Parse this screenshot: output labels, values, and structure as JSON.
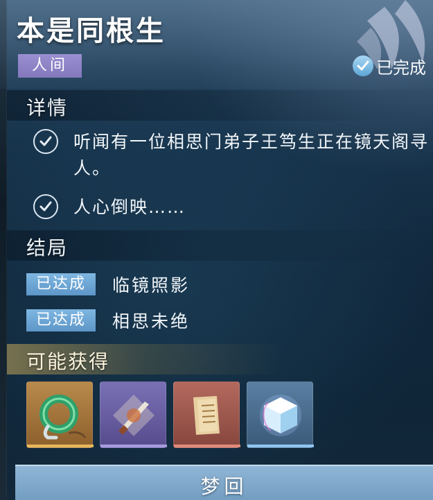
{
  "header": {
    "title": "本是同根生",
    "realm_tag": "人间",
    "status": "已完成"
  },
  "details": {
    "heading": "详情",
    "items": [
      {
        "text": "听闻有一位相思门弟子王笃生正在镜天阁寻人。"
      },
      {
        "text": "人心倒映……"
      }
    ]
  },
  "endings": {
    "heading": "结局",
    "items": [
      {
        "badge": "已达成",
        "name": "临镜照影"
      },
      {
        "badge": "已达成",
        "name": "相思未绝"
      }
    ]
  },
  "rewards": {
    "heading": "可能获得",
    "items": [
      {
        "icon": "jade-ring-icon",
        "rarity": "gold",
        "color": "#b88a4c"
      },
      {
        "icon": "dagger-icon",
        "rarity": "purple",
        "color": "#7a70b5"
      },
      {
        "icon": "scroll-page-icon",
        "rarity": "red",
        "color": "#b46a5e"
      },
      {
        "icon": "ice-cube-icon",
        "rarity": "blue",
        "color": "#5a7fa2"
      }
    ]
  },
  "action": {
    "label": "梦回"
  }
}
